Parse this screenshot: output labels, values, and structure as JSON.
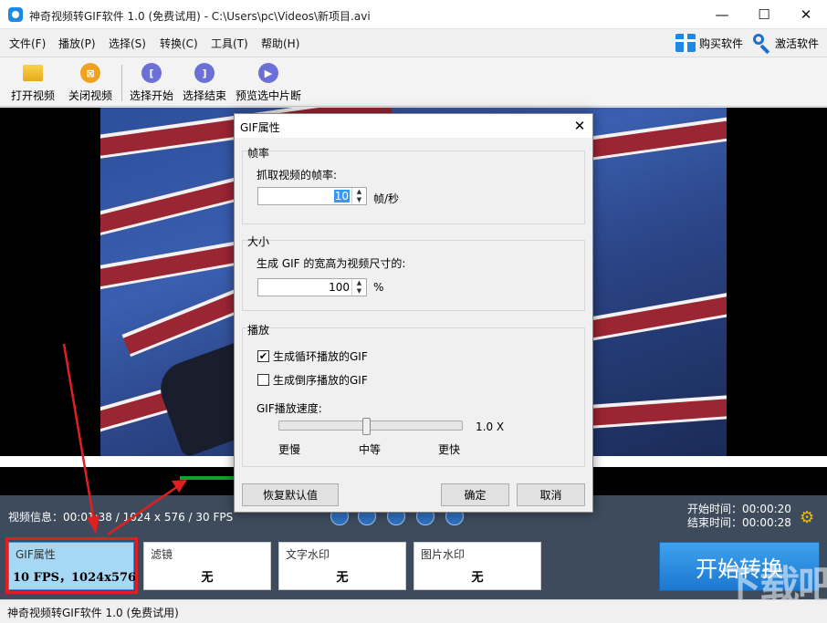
{
  "window": {
    "title": "神奇视频转GIF软件 1.0 (免费试用) - C:\\Users\\pc\\Videos\\新项目.avi",
    "minimize": "—",
    "maximize": "☐",
    "close": "✕"
  },
  "menu": {
    "items": [
      "文件(F)",
      "播放(P)",
      "选择(S)",
      "转换(C)",
      "工具(T)",
      "帮助(H)"
    ],
    "buy": "购买软件",
    "activate": "激活软件"
  },
  "toolbar": {
    "items": [
      "打开视频",
      "关闭视频",
      "选择开始",
      "选择结束",
      "预览选中片断"
    ]
  },
  "info": {
    "video_info": "视频信息：00:01:38 / 1024 x 576 / 30 FPS",
    "start_time_label": "开始时间：",
    "start_time": "00:00:20",
    "end_time_label": "结束时间：",
    "end_time": "00:00:28"
  },
  "cards": {
    "gif": {
      "title": "GIF属性",
      "value": "10 FPS，1024x576"
    },
    "filter": {
      "title": "滤镜",
      "value": "无"
    },
    "text_wm": {
      "title": "文字水印",
      "value": "无"
    },
    "image_wm": {
      "title": "图片水印",
      "value": "无"
    }
  },
  "start_button": "开始转换",
  "status": "神奇视频转GIF软件 1.0 (免费试用)",
  "watermark": "下载吧",
  "dialog": {
    "title": "GIF属性",
    "framerate": {
      "group": "帧率",
      "label": "抓取视频的帧率:",
      "value": "10",
      "unit": "帧/秒"
    },
    "size": {
      "group": "大小",
      "label": "生成 GIF 的宽高为视频尺寸的:",
      "value": "100",
      "unit": "%"
    },
    "playback": {
      "group": "播放",
      "loop_label": "生成循环播放的GIF",
      "loop_checked": true,
      "reverse_label": "生成倒序播放的GIF",
      "reverse_checked": false,
      "speed_label": "GIF播放速度:",
      "speed_value": "1.0 X",
      "speed_level": 0.48,
      "slow": "更慢",
      "medium": "中等",
      "fast": "更快"
    },
    "buttons": {
      "reset": "恢复默认值",
      "ok": "确定",
      "cancel": "取消"
    }
  },
  "colors": {
    "accent": "#1c78cf",
    "info_bar": "#3d4b5c",
    "highlight_box": "#e02020"
  }
}
